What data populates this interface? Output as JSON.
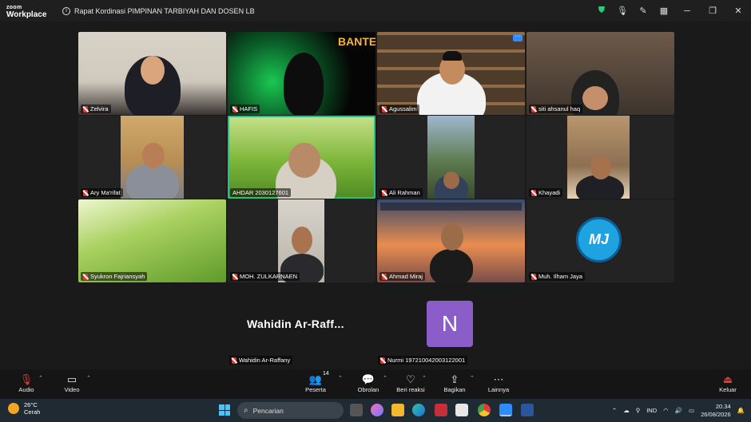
{
  "app": {
    "logo_line1": "zoom",
    "logo_line2": "Workplace",
    "meeting_title": "Rapat Kordinasi PIMPINAN TARBIYAH DAN DOSEN LB"
  },
  "titlebar_icons": [
    "shield-icon",
    "mic-settings-icon",
    "pen-icon",
    "grid-icon",
    "minimize-icon",
    "maximize-icon",
    "close-icon"
  ],
  "participants": [
    {
      "name": "Zelvira"
    },
    {
      "name": "HAFIS"
    },
    {
      "name": "Agussalim"
    },
    {
      "name": "siti ahsanul haq"
    },
    {
      "name": "Ary Ma'rifat"
    },
    {
      "name": "AHDAR 2030127601"
    },
    {
      "name": "Ali Rahman"
    },
    {
      "name": "Khayadi"
    },
    {
      "name": "Syukron Fajriansyah"
    },
    {
      "name": "MOH. ZULKARNAEN"
    },
    {
      "name": "Ahmad Miraj"
    },
    {
      "name": "Muh. Ilham Jaya"
    }
  ],
  "tile_badges": {
    "hafis_overlay": "BANTEN",
    "ilham_logo": "MJ"
  },
  "bottom_row": {
    "wahidin_display": "Wahidin  Ar-Raff...",
    "wahidin_label": "Wahidin Ar-Raffany",
    "nurmi_initial": "N",
    "nurmi_label": "Nurmi 197210042003122001"
  },
  "toolbar": {
    "audio": "Audio",
    "video": "Video",
    "participants": "Peserta",
    "participants_count": "14",
    "chat": "Obrolan",
    "reactions": "Beri reaksi",
    "share": "Bagikan",
    "more": "Lainnya",
    "leave": "Keluar"
  },
  "taskbar": {
    "temp": "26°C",
    "weather": "Cerah",
    "search_placeholder": "Pencarian",
    "lang": "IND",
    "time": "20.34",
    "date": "26/08/2026"
  },
  "colors": {
    "active_speaker": "#26c281",
    "mute": "#e53935",
    "nurmi_avatar": "#8b5dc9",
    "zoom_blue": "#2d8cff"
  }
}
